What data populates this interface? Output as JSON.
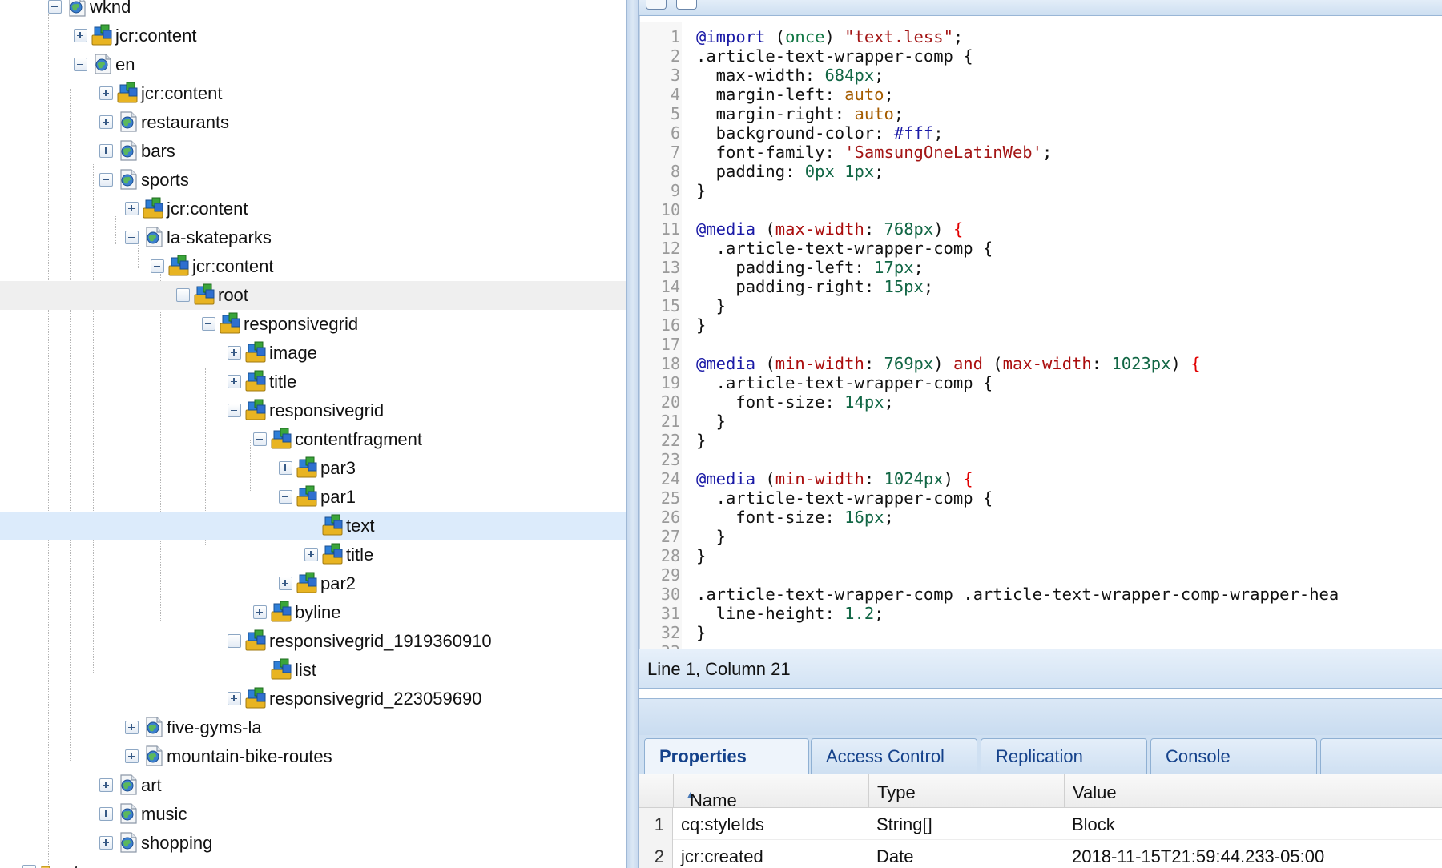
{
  "tree": {
    "items": [
      {
        "label": "wknd",
        "depth": 1,
        "toggle": "minus",
        "icon": "globe-page-icon"
      },
      {
        "label": "jcr:content",
        "depth": 2,
        "toggle": "plus",
        "icon": "content-node-icon"
      },
      {
        "label": "en",
        "depth": 2,
        "toggle": "minus",
        "icon": "globe-page-icon"
      },
      {
        "label": "jcr:content",
        "depth": 3,
        "toggle": "plus",
        "icon": "content-node-icon"
      },
      {
        "label": "restaurants",
        "depth": 3,
        "toggle": "plus",
        "icon": "globe-page-icon"
      },
      {
        "label": "bars",
        "depth": 3,
        "toggle": "plus",
        "icon": "globe-page-icon"
      },
      {
        "label": "sports",
        "depth": 3,
        "toggle": "minus",
        "icon": "globe-page-icon"
      },
      {
        "label": "jcr:content",
        "depth": 4,
        "toggle": "plus",
        "icon": "content-node-icon"
      },
      {
        "label": "la-skateparks",
        "depth": 4,
        "toggle": "minus",
        "icon": "globe-page-icon"
      },
      {
        "label": "jcr:content",
        "depth": 5,
        "toggle": "minus",
        "icon": "content-node-icon"
      },
      {
        "label": "root",
        "depth": 6,
        "toggle": "minus",
        "icon": "content-node-icon",
        "state": "hover"
      },
      {
        "label": "responsivegrid",
        "depth": 7,
        "toggle": "minus",
        "icon": "content-node-icon"
      },
      {
        "label": "image",
        "depth": 8,
        "toggle": "plus",
        "icon": "content-node-icon"
      },
      {
        "label": "title",
        "depth": 8,
        "toggle": "plus",
        "icon": "content-node-icon"
      },
      {
        "label": "responsivegrid",
        "depth": 8,
        "toggle": "minus",
        "icon": "content-node-icon"
      },
      {
        "label": "contentfragment",
        "depth": 9,
        "toggle": "minus",
        "icon": "content-node-icon"
      },
      {
        "label": "par3",
        "depth": 10,
        "toggle": "plus",
        "icon": "content-node-icon"
      },
      {
        "label": "par1",
        "depth": 10,
        "toggle": "minus",
        "icon": "content-node-icon"
      },
      {
        "label": "text",
        "depth": 11,
        "toggle": "none",
        "icon": "content-node-icon",
        "state": "selected"
      },
      {
        "label": "title",
        "depth": 11,
        "toggle": "plus",
        "icon": "content-node-icon"
      },
      {
        "label": "par2",
        "depth": 10,
        "toggle": "plus",
        "icon": "content-node-icon"
      },
      {
        "label": "byline",
        "depth": 9,
        "toggle": "plus",
        "icon": "content-node-icon"
      },
      {
        "label": "responsivegrid_1919360910",
        "depth": 8,
        "toggle": "minus",
        "icon": "content-node-icon"
      },
      {
        "label": "list",
        "depth": 9,
        "toggle": "none",
        "icon": "content-node-icon"
      },
      {
        "label": "responsivegrid_223059690",
        "depth": 8,
        "toggle": "plus",
        "icon": "content-node-icon"
      },
      {
        "label": "five-gyms-la",
        "depth": 4,
        "toggle": "plus",
        "icon": "globe-page-icon"
      },
      {
        "label": "mountain-bike-routes",
        "depth": 4,
        "toggle": "plus",
        "icon": "globe-page-icon"
      },
      {
        "label": "art",
        "depth": 3,
        "toggle": "plus",
        "icon": "globe-page-icon"
      },
      {
        "label": "music",
        "depth": 3,
        "toggle": "plus",
        "icon": "globe-page-icon"
      },
      {
        "label": "shopping",
        "depth": 3,
        "toggle": "plus",
        "icon": "globe-page-icon"
      },
      {
        "label": "etc",
        "depth": 0,
        "toggle": "plus",
        "icon": "folder-icon"
      }
    ]
  },
  "editor": {
    "lines": [
      [
        [
          "@import",
          "at"
        ],
        [
          " (",
          "p"
        ],
        [
          "once",
          "par"
        ],
        [
          ") ",
          "p"
        ],
        [
          "\"text.less\"",
          "str"
        ],
        [
          ";",
          "p"
        ]
      ],
      [
        [
          ".article-text-wrapper-comp {",
          "p"
        ]
      ],
      [
        [
          "  max-width: ",
          "p"
        ],
        [
          "684px",
          "num"
        ],
        [
          ";",
          "p"
        ]
      ],
      [
        [
          "  margin-left: ",
          "p"
        ],
        [
          "auto",
          "kw2"
        ],
        [
          ";",
          "p"
        ]
      ],
      [
        [
          "  margin-right: ",
          "p"
        ],
        [
          "auto",
          "kw2"
        ],
        [
          ";",
          "p"
        ]
      ],
      [
        [
          "  background-color: ",
          "p"
        ],
        [
          "#fff",
          "hex"
        ],
        [
          ";",
          "p"
        ]
      ],
      [
        [
          "  font-family: ",
          "p"
        ],
        [
          "'SamsungOneLatinWeb'",
          "str"
        ],
        [
          ";",
          "p"
        ]
      ],
      [
        [
          "  padding: ",
          "p"
        ],
        [
          "0px 1px",
          "num"
        ],
        [
          ";",
          "p"
        ]
      ],
      [
        [
          "}",
          "p"
        ]
      ],
      [
        [
          "",
          "p"
        ]
      ],
      [
        [
          "@media",
          "at"
        ],
        [
          " (",
          "p"
        ],
        [
          "max-width",
          "kw"
        ],
        [
          ": ",
          "p"
        ],
        [
          "768px",
          "num"
        ],
        [
          ") ",
          "p"
        ],
        [
          "{",
          "red"
        ]
      ],
      [
        [
          "  .article-text-wrapper-comp {",
          "p"
        ]
      ],
      [
        [
          "    padding-left: ",
          "p"
        ],
        [
          "17px",
          "num"
        ],
        [
          ";",
          "p"
        ]
      ],
      [
        [
          "    padding-right: ",
          "p"
        ],
        [
          "15px",
          "num"
        ],
        [
          ";",
          "p"
        ]
      ],
      [
        [
          "  }",
          "p"
        ]
      ],
      [
        [
          "}",
          "p"
        ]
      ],
      [
        [
          "",
          "p"
        ]
      ],
      [
        [
          "@media",
          "at"
        ],
        [
          " (",
          "p"
        ],
        [
          "min-width",
          "kw"
        ],
        [
          ": ",
          "p"
        ],
        [
          "769px",
          "num"
        ],
        [
          ") ",
          "p"
        ],
        [
          "and",
          "kw"
        ],
        [
          " (",
          "p"
        ],
        [
          "max-width",
          "kw"
        ],
        [
          ": ",
          "p"
        ],
        [
          "1023px",
          "num"
        ],
        [
          ") ",
          "p"
        ],
        [
          "{",
          "red"
        ]
      ],
      [
        [
          "  .article-text-wrapper-comp {",
          "p"
        ]
      ],
      [
        [
          "    font-size: ",
          "p"
        ],
        [
          "14px",
          "num"
        ],
        [
          ";",
          "p"
        ]
      ],
      [
        [
          "  }",
          "p"
        ]
      ],
      [
        [
          "}",
          "p"
        ]
      ],
      [
        [
          "",
          "p"
        ]
      ],
      [
        [
          "@media",
          "at"
        ],
        [
          " (",
          "p"
        ],
        [
          "min-width",
          "kw"
        ],
        [
          ": ",
          "p"
        ],
        [
          "1024px",
          "num"
        ],
        [
          ") ",
          "p"
        ],
        [
          "{",
          "red"
        ]
      ],
      [
        [
          "  .article-text-wrapper-comp {",
          "p"
        ]
      ],
      [
        [
          "    font-size: ",
          "p"
        ],
        [
          "16px",
          "num"
        ],
        [
          ";",
          "p"
        ]
      ],
      [
        [
          "  }",
          "p"
        ]
      ],
      [
        [
          "}",
          "p"
        ]
      ],
      [
        [
          "",
          "p"
        ]
      ],
      [
        [
          ".article-text-wrapper-comp .article-text-wrapper-comp-wrapper-hea",
          "p"
        ]
      ],
      [
        [
          "  line-height: ",
          "p"
        ],
        [
          "1.2",
          "num"
        ],
        [
          ";",
          "p"
        ]
      ],
      [
        [
          "}",
          "p"
        ]
      ],
      [
        [
          "",
          "p"
        ]
      ]
    ],
    "status": "Line 1, Column 21"
  },
  "tabs": [
    {
      "label": "Properties",
      "active": true
    },
    {
      "label": "Access Control",
      "active": false
    },
    {
      "label": "Replication",
      "active": false
    },
    {
      "label": "Console",
      "active": false
    }
  ],
  "grid": {
    "columns": {
      "name": "Name",
      "type": "Type",
      "value": "Value"
    },
    "sort_indicator": "▲",
    "rows": [
      {
        "num": "1",
        "name": "cq:styleIds",
        "type": "String[]",
        "value": "Block"
      },
      {
        "num": "2",
        "name": "jcr:created",
        "type": "Date",
        "value": "2018-11-15T21:59:44.233-05:00"
      }
    ]
  },
  "colors": {
    "selection": "#dcebfb",
    "hover": "#efefef",
    "tab_text": "#15428b",
    "panel_blue": "#cfe0f2"
  }
}
